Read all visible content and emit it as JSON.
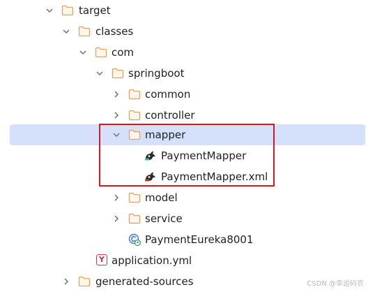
{
  "tree": {
    "items": [
      {
        "label": "target",
        "type": "folder",
        "expanded": true
      },
      {
        "label": "classes",
        "type": "folder",
        "expanded": true
      },
      {
        "label": "com",
        "type": "folder",
        "expanded": true
      },
      {
        "label": "springboot",
        "type": "folder",
        "expanded": true
      },
      {
        "label": "common",
        "type": "folder",
        "expanded": false
      },
      {
        "label": "controller",
        "type": "folder",
        "expanded": false
      },
      {
        "label": "mapper",
        "type": "folder",
        "expanded": true,
        "selected": true
      },
      {
        "label": "PaymentMapper",
        "type": "mybatis-mapper"
      },
      {
        "label": "PaymentMapper.xml",
        "type": "mybatis-xml"
      },
      {
        "label": "model",
        "type": "folder",
        "expanded": false
      },
      {
        "label": "service",
        "type": "folder",
        "expanded": false
      },
      {
        "label": "PaymentEureka8001",
        "type": "spring-class"
      },
      {
        "label": "application.yml",
        "type": "yaml"
      },
      {
        "label": "generated-sources",
        "type": "folder",
        "expanded": false
      }
    ]
  },
  "colors": {
    "selection": "#d5e1fb",
    "highlight_border": "#e0141e",
    "folder_stroke": "#e8a062"
  },
  "yml_icon_glyph": "Y",
  "watermark": "CSDN @幸运码农"
}
